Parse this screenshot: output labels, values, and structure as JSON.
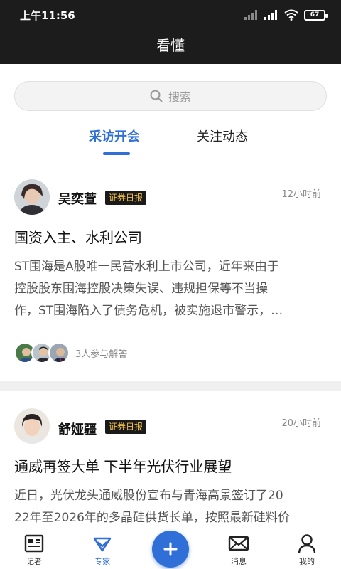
{
  "status_bar": {
    "time": "上午11:56",
    "battery": "67"
  },
  "header": {
    "title": "看懂"
  },
  "search": {
    "placeholder": "搜索"
  },
  "tabs": [
    {
      "label": "采访开会",
      "active": true
    },
    {
      "label": "关注动态",
      "active": false
    }
  ],
  "feed": [
    {
      "author": "吴奕萱",
      "badge": "证券日报",
      "time": "12小时前",
      "headline": "国资入主、水利公司",
      "excerpt_lines": [
        "ST围海是A股唯一民营水利上市公司，近年来由于",
        "控股股东围海控股决策失误、违规担保等不当操",
        "作，ST围海陷入了债务危机，被实施退市警示，…"
      ],
      "participants_text": "3人参与解答"
    },
    {
      "author": "舒娅疆",
      "badge": "证券日报",
      "time": "20小时前",
      "headline": "通威再签大单 下半年光伏行业展望",
      "excerpt_lines": [
        "近日，光伏龙头通威股份宣布与青海高景签订了20",
        "22年至2026年的多晶硅供货长单，按照最新硅料价"
      ]
    }
  ],
  "bottom_nav": [
    {
      "label": "记者",
      "icon": "newspaper-icon",
      "active": false
    },
    {
      "label": "专家",
      "icon": "diamond-icon",
      "active": true
    },
    {
      "label": "",
      "icon": "plus-icon",
      "active": false
    },
    {
      "label": "消息",
      "icon": "mail-icon",
      "active": false
    },
    {
      "label": "我的",
      "icon": "person-icon",
      "active": false
    }
  ],
  "colors": {
    "accent": "#2f6fd7",
    "header_bg": "#1c1c1c",
    "badge_text": "#f2c14a"
  }
}
